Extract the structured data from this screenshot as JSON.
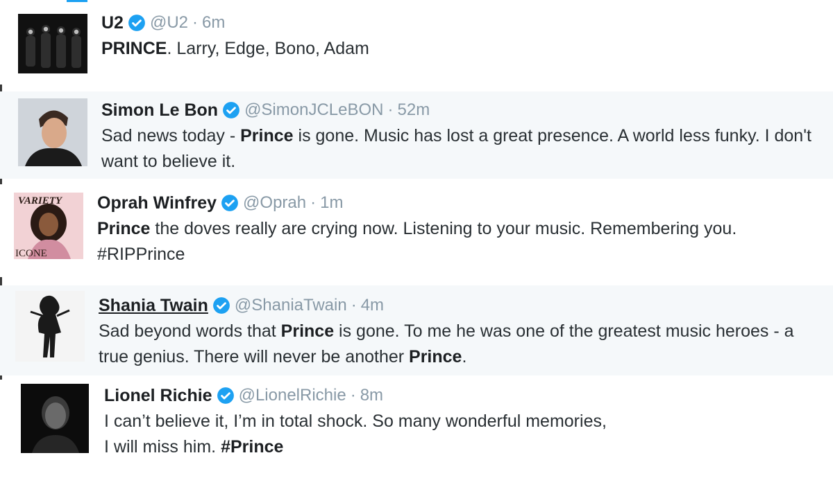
{
  "tweets": [
    {
      "name": "U2",
      "handle": "@U2",
      "time": "6m",
      "segments": [
        {
          "bold": true,
          "text": "PRINCE"
        },
        {
          "bold": false,
          "text": ".  Larry, Edge, Bono, Adam"
        }
      ],
      "avatar_icon": "band-photo-avatar"
    },
    {
      "name": "Simon Le Bon",
      "handle": "@SimonJCLeBON",
      "time": "52m",
      "segments": [
        {
          "bold": false,
          "text": "Sad news today - "
        },
        {
          "bold": true,
          "text": "Prince"
        },
        {
          "bold": false,
          "text": " is gone. Music has lost a great presence. A world less funky. I don't want to believe it."
        }
      ],
      "avatar_icon": "portrait-avatar"
    },
    {
      "name": "Oprah Winfrey",
      "handle": "@Oprah",
      "time": "1m",
      "segments": [
        {
          "bold": true,
          "text": "Prince"
        },
        {
          "bold": false,
          "text": " the doves really are crying now. Listening to your music. Remembering you. #RIPPrince"
        }
      ],
      "avatar_icon": "magazine-cover-avatar",
      "avatar_text_top": "VARIETY",
      "avatar_text_bottom": "ICONE"
    },
    {
      "name": "Shania Twain",
      "handle": "@ShaniaTwain",
      "time": "4m",
      "segments": [
        {
          "bold": false,
          "text": "Sad beyond words that "
        },
        {
          "bold": true,
          "text": "Prince"
        },
        {
          "bold": false,
          "text": " is gone. To me he was one of the greatest music heroes - a true genius. There will never be another "
        },
        {
          "bold": true,
          "text": "Prince"
        },
        {
          "bold": false,
          "text": "."
        }
      ],
      "avatar_icon": "silhouette-avatar"
    },
    {
      "name": "Lionel Richie",
      "handle": "@LionelRichie",
      "time": "8m",
      "segments": [
        {
          "bold": false,
          "text": "I can’t believe it, I’m in total shock. So many wonderful memories,\nI will miss him. "
        },
        {
          "bold": true,
          "text": "#Prince"
        }
      ],
      "avatar_icon": "portrait-dark-avatar"
    }
  ],
  "separator": "·",
  "colors": {
    "verified": "#1da1f2",
    "meta": "#8899a6",
    "alt_row": "#f5f8fa",
    "text": "#292f33"
  }
}
